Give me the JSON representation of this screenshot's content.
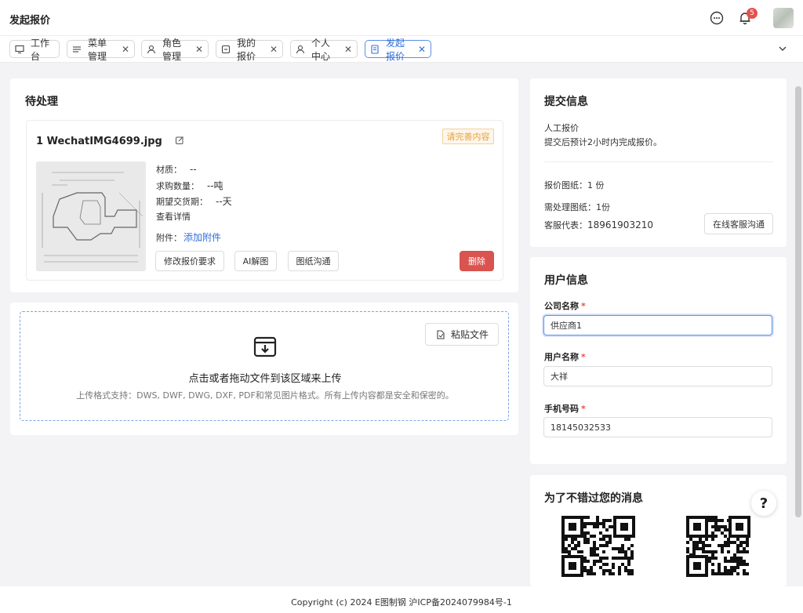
{
  "header": {
    "title": "发起报价",
    "notification_count": "5"
  },
  "tabs": [
    {
      "label": "工作台",
      "icon": "monitor-icon",
      "closable": false
    },
    {
      "label": "菜单管理",
      "icon": "list-icon",
      "closable": true
    },
    {
      "label": "角色管理",
      "icon": "user-icon",
      "closable": true
    },
    {
      "label": "我的报价",
      "icon": "quote-icon",
      "closable": true
    },
    {
      "label": "个人中心",
      "icon": "user-icon",
      "closable": true
    },
    {
      "label": "发起报价",
      "icon": "doc-icon",
      "closable": true,
      "active": true
    }
  ],
  "pending": {
    "title": "待处理",
    "file_name": "1 WechatIMG4699.jpg",
    "status_tag": "请完善内容",
    "material_label": "材质：",
    "material_value": "--",
    "qty_label": "求购数量：",
    "qty_value": "--吨",
    "delivery_label": "期望交货期：",
    "delivery_value": "--天",
    "detail_link": "查看详情",
    "attach_label": "附件：",
    "attach_link": "添加附件",
    "buttons": {
      "modify": "修改报价要求",
      "ai": "AI解图",
      "chat": "图纸沟通",
      "delete": "删除"
    }
  },
  "upload": {
    "paste_label": "粘贴文件",
    "main_text": "点击或者拖动文件到该区域来上传",
    "sub_text": "上传格式支持：DWS, DWF, DWG, DXF, PDF和常见图片格式。所有上传内容都是安全和保密的。"
  },
  "submit_info": {
    "title": "提交信息",
    "mode": "人工报价",
    "note": "提交后预计2小时内完成报价。",
    "drawings": "报价图纸：1 份",
    "to_process": "需处理图纸：1份",
    "rep_label": "客服代表：",
    "rep_phone": "18961903210",
    "chat_button": "在线客服沟通"
  },
  "user_info": {
    "title": "用户信息",
    "company_label": "公司名称",
    "company_value": "供应商1",
    "user_label": "用户名称",
    "user_value": "大祥",
    "phone_label": "手机号码",
    "phone_value": "18145032533",
    "required_mark": "*"
  },
  "notify": {
    "title": "为了不错过您的消息"
  },
  "help_label": "?",
  "footer": "Copyright (c) 2024 E图制钢    沪ICP备2024079984号-1",
  "colors": {
    "primary": "#2f6fdc",
    "danger": "#d9534f",
    "warning": "#e6a23c",
    "badge": "#e8504a"
  }
}
